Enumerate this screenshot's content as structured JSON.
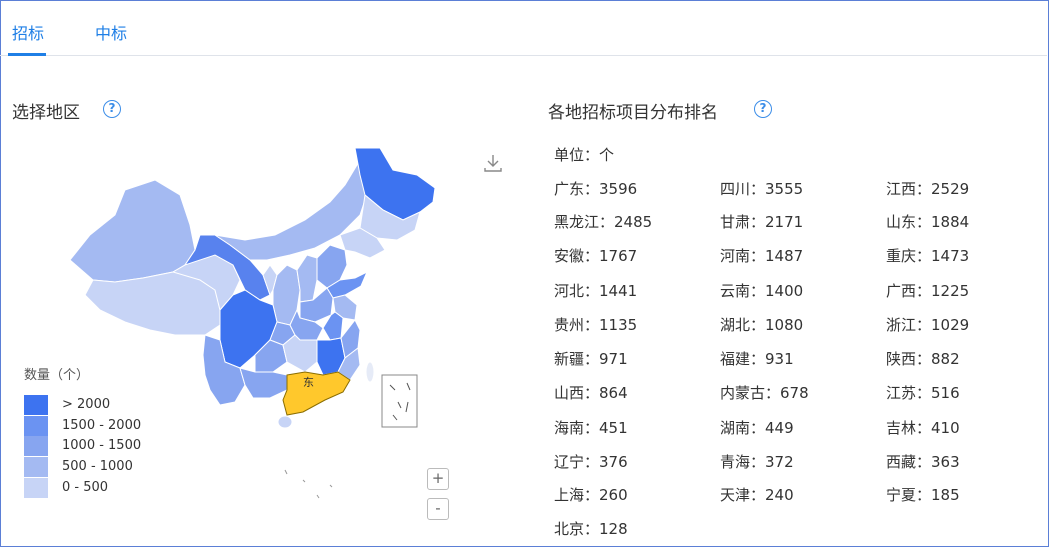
{
  "tabs": [
    {
      "label": "招标",
      "active": true
    },
    {
      "label": "中标",
      "active": false
    }
  ],
  "region_section": {
    "title": "选择地区",
    "help_icon": "question-circle-icon"
  },
  "ranking_section": {
    "title": "各地招标项目分布排名",
    "help_icon": "question-circle-icon"
  },
  "map": {
    "selected_region": "广东",
    "selected_color": "#ffc82c",
    "legend": {
      "title": "数量（个）",
      "items": [
        {
          "label": "> 2000",
          "color": "#3d73f0"
        },
        {
          "label": "1500 - 2000",
          "color": "#6b93f2"
        },
        {
          "label": "1000 - 1500",
          "color": "#87a5f0"
        },
        {
          "label": "500 - 1000",
          "color": "#a4baf2"
        },
        {
          "label": "0 - 500",
          "color": "#c7d4f6"
        }
      ]
    },
    "controls": {
      "download_icon": "download-icon",
      "zoom_in": "+",
      "zoom_out": "-"
    }
  },
  "ranking": {
    "unit": "单位：个",
    "items": [
      "广东：3596",
      "四川：3555",
      "江西：2529",
      "黑龙江：2485",
      "甘肃：2171",
      "山东：1884",
      "安徽：1767",
      "河南：1487",
      "重庆：1473",
      "河北：1441",
      "云南：1400",
      "广西：1225",
      "贵州：1135",
      "湖北：1080",
      "浙江：1029",
      "新疆：971",
      "福建：931",
      "陕西：882",
      "山西：864",
      "内蒙古：678",
      "江苏：516",
      "海南：451",
      "湖南：449",
      "吉林：410",
      "辽宁：376",
      "青海：372",
      "西藏：363",
      "上海：260",
      "天津：240",
      "宁夏：185",
      "北京：128"
    ]
  }
}
